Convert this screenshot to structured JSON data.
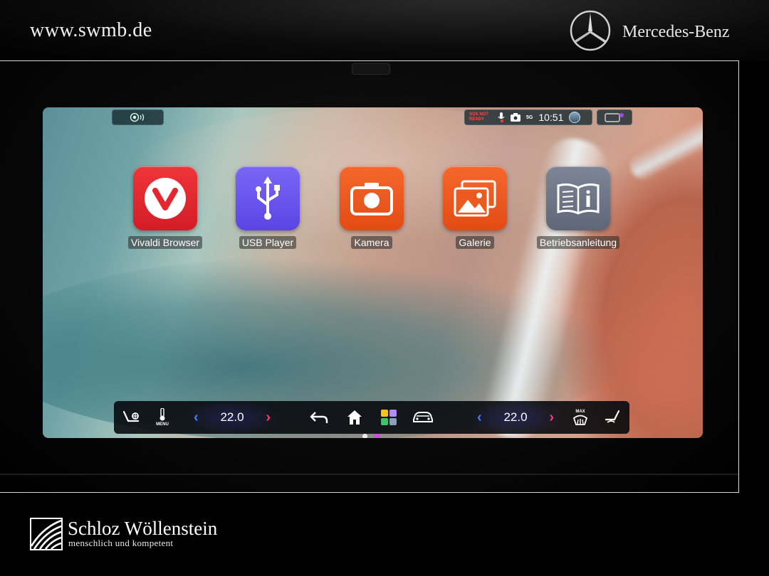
{
  "header": {
    "site_url": "www.swmb.de",
    "brand_name": "Mercedes-Benz"
  },
  "screen": {
    "status": {
      "sos_label": "SOS NOT READY",
      "network": "5G",
      "time": "10:51"
    },
    "apps": [
      {
        "label": "Vivaldi Browser",
        "icon": "vivaldi-icon",
        "color": "#e8232d"
      },
      {
        "label": "USB Player",
        "icon": "usb-icon",
        "color": "#6f57f0"
      },
      {
        "label": "Kamera",
        "icon": "camera-icon",
        "color": "#f2561f"
      },
      {
        "label": "Galerie",
        "icon": "gallery-icon",
        "color": "#f2561f"
      },
      {
        "label": "Betriebsanleitung",
        "icon": "manual-icon",
        "color": "#6b7384"
      }
    ],
    "page_indicator": {
      "pages": 2,
      "current": 2
    },
    "climate": {
      "menu_label": "MENU",
      "left_temp": "22.0",
      "right_temp": "22.0",
      "defrost_label": "MAX"
    }
  },
  "footer": {
    "dealer_name": "Schloz Wöllenstein",
    "dealer_tagline": "menschlich und kompetent"
  }
}
